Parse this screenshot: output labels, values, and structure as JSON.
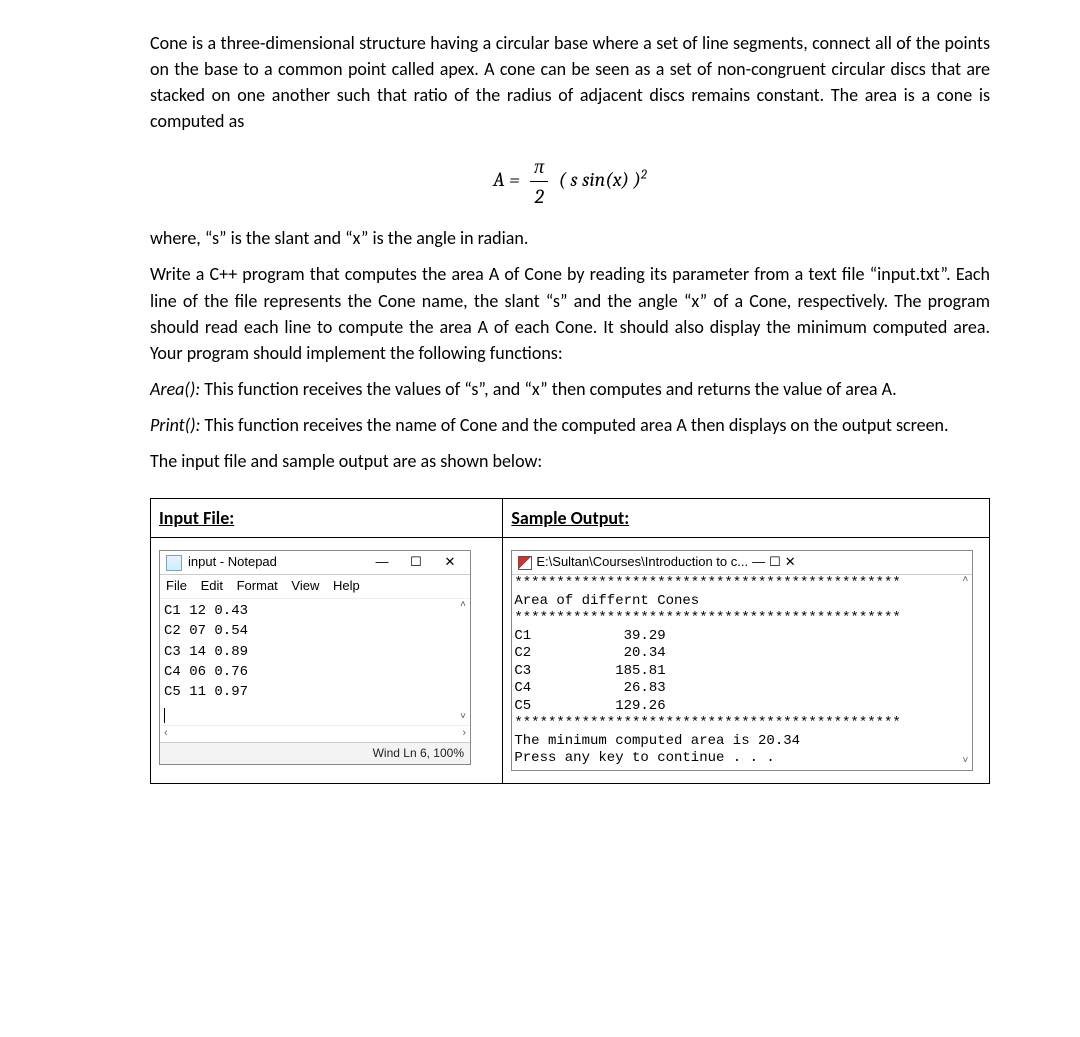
{
  "para1": "Cone is a three-dimensional structure having a circular base where a set of line segments, connect all of the points on the base to a common point called apex. A cone can be seen as a set of non-congruent circular discs that are stacked on one another such that ratio of the radius of adjacent discs remains constant. The area is a cone is computed as",
  "formula": {
    "lhs": "A =",
    "frac_top": "π",
    "frac_bot": "2",
    "rhs_open": " ( s  sin(",
    "rhs_x": "x",
    "rhs_close": ") )",
    "sup": "2"
  },
  "para2": "where, “s” is the slant and “x” is the angle in radian.",
  "para3": "Write a C++ program that computes the area A of Cone by reading its parameter from a text file “input.txt”. Each line of the file represents the Cone name, the slant “s” and the angle “x” of a Cone, respectively. The program should read each line to compute the area A of each Cone. It should also display the minimum computed area. Your program should implement the following functions:",
  "func_area": "Area():",
  "para4": "  This function receives the values of “s”, and “x” then computes and returns the value of area A.",
  "func_print": "Print():",
  "para5": " This function receives the name of Cone and the computed area A then displays on the output screen.",
  "para6": "The input file and sample output are as shown below:",
  "table": {
    "h1": "Input File:",
    "h2": "Sample Output:"
  },
  "notepad": {
    "title": "input - Notepad",
    "menu": [
      "File",
      "Edit",
      "Format",
      "View",
      "Help"
    ],
    "lines": [
      "C1 12 0.43",
      "C2 07 0.54",
      "C3 14 0.89",
      "C4 06 0.76",
      "C5 11 0.97"
    ],
    "status": "Wind   Ln 6,  100%"
  },
  "console": {
    "title": "E:\\Sultan\\Courses\\Introduction to c...",
    "sep": "**********************************************",
    "header": "Area of differnt Cones",
    "rows": [
      {
        "name": "C1",
        "val": "39.29"
      },
      {
        "name": "C2",
        "val": "20.34"
      },
      {
        "name": "C3",
        "val": "185.81"
      },
      {
        "name": "C4",
        "val": "26.83"
      },
      {
        "name": "C5",
        "val": "129.26"
      }
    ],
    "minline": "The minimum computed area is 20.34",
    "press": "Press any key to continue . . ."
  },
  "chart_data": {
    "type": "table",
    "input_file": [
      {
        "name": "C1",
        "s": 12,
        "x": 0.43
      },
      {
        "name": "C2",
        "s": 7,
        "x": 0.54
      },
      {
        "name": "C3",
        "s": 14,
        "x": 0.89
      },
      {
        "name": "C4",
        "s": 6,
        "x": 0.76
      },
      {
        "name": "C5",
        "s": 11,
        "x": 0.97
      }
    ],
    "output_areas": [
      {
        "name": "C1",
        "area": 39.29
      },
      {
        "name": "C2",
        "area": 20.34
      },
      {
        "name": "C3",
        "area": 185.81
      },
      {
        "name": "C4",
        "area": 26.83
      },
      {
        "name": "C5",
        "area": 129.26
      }
    ],
    "minimum": 20.34
  }
}
